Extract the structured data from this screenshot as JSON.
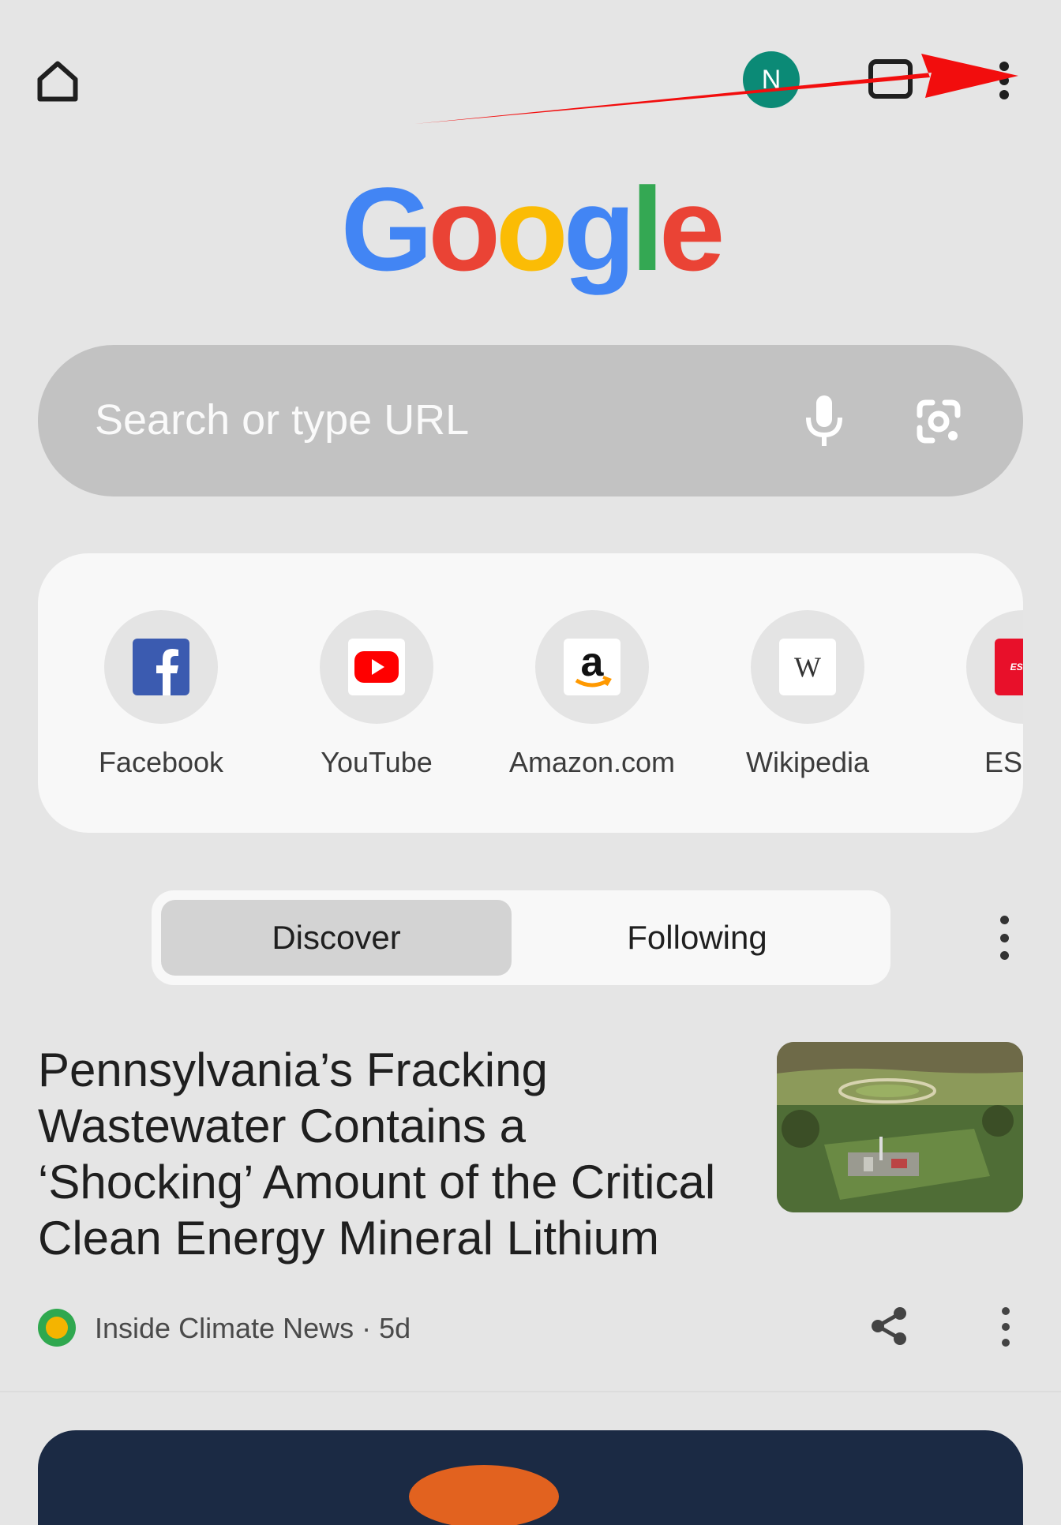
{
  "toolbar": {
    "avatar_letter": "N",
    "tab_count": ""
  },
  "logo": {
    "letters": [
      "G",
      "o",
      "o",
      "g",
      "l",
      "e"
    ]
  },
  "search": {
    "placeholder": "Search or type URL"
  },
  "shortcuts": [
    {
      "label": "Facebook",
      "icon": "facebook-icon"
    },
    {
      "label": "YouTube",
      "icon": "youtube-icon"
    },
    {
      "label": "Amazon.com",
      "icon": "amazon-icon"
    },
    {
      "label": "Wikipedia",
      "icon": "wikipedia-icon"
    },
    {
      "label": "ESPN",
      "icon": "espn-icon"
    }
  ],
  "feed_tabs": {
    "discover": "Discover",
    "following": "Following"
  },
  "article": {
    "headline": "Pennsylvania’s Fracking Wastewater Contains a ‘Shocking’ Amount of the Critical Clean Energy Mineral Lithium",
    "source": "Inside Climate News · 5d"
  },
  "colors": {
    "avatar": "#0b8a76",
    "annotation_arrow": "#f20d0d",
    "search_bg": "#c2c2c2"
  }
}
